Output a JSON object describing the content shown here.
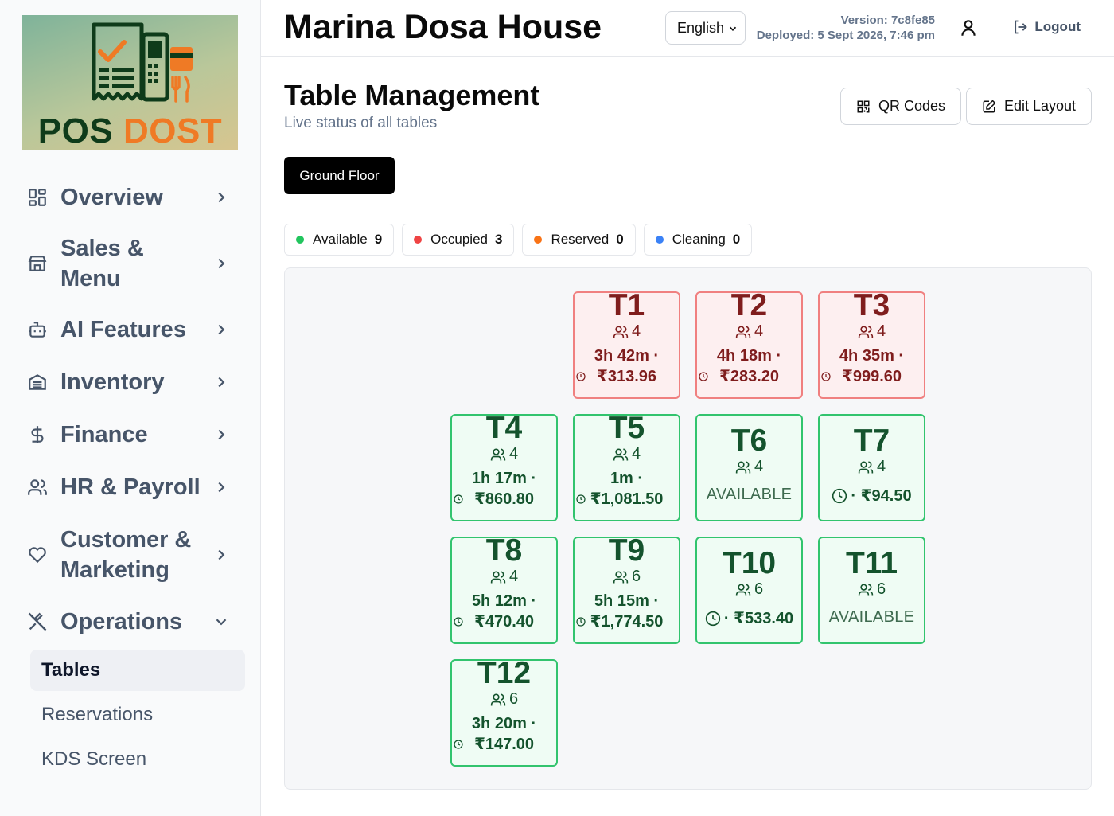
{
  "logo": {
    "word1": "POS",
    "word2": "DOST"
  },
  "sidebar": {
    "items": [
      {
        "label": "Overview",
        "icon": "layout-grid-icon"
      },
      {
        "label": "Sales & Menu",
        "icon": "store-icon"
      },
      {
        "label": "AI Features",
        "icon": "bot-icon"
      },
      {
        "label": "Inventory",
        "icon": "warehouse-icon"
      },
      {
        "label": "Finance",
        "icon": "dollar-icon"
      },
      {
        "label": "HR & Payroll",
        "icon": "users-icon"
      },
      {
        "label": "Customer & Marketing",
        "icon": "heart-icon"
      },
      {
        "label": "Operations",
        "icon": "utensils-crossed-icon"
      }
    ],
    "sub_items": [
      {
        "label": "Tables",
        "active": true
      },
      {
        "label": "Reservations",
        "active": false
      },
      {
        "label": "KDS Screen",
        "active": false
      }
    ]
  },
  "header": {
    "title": "Marina Dosa House",
    "language": "English",
    "version": "Version: 7c8fe85",
    "deployed": "Deployed: 5 Sept 2026, 7:46 pm",
    "logout": "Logout"
  },
  "main": {
    "title": "Table Management",
    "subtitle": "Live status of all tables",
    "qr_button": "QR Codes",
    "edit_button": "Edit Layout",
    "floor_tab": "Ground Floor"
  },
  "status_chips": [
    {
      "label": "Available",
      "count": "9",
      "color": "#22c55e"
    },
    {
      "label": "Occupied",
      "count": "3",
      "color": "#ef4444"
    },
    {
      "label": "Reserved",
      "count": "0",
      "color": "#f97316"
    },
    {
      "label": "Cleaning",
      "count": "0",
      "color": "#3b82f6"
    }
  ],
  "tables": [
    {
      "name": "T1",
      "seats": "4",
      "time": "3h 42m ·",
      "amount": "₹313.96",
      "style": "red"
    },
    {
      "name": "T2",
      "seats": "4",
      "time": "4h 18m ·",
      "amount": "₹283.20",
      "style": "red"
    },
    {
      "name": "T3",
      "seats": "4",
      "time": "4h 35m ·",
      "amount": "₹999.60",
      "style": "red"
    },
    {
      "name": "T4",
      "seats": "4",
      "time": "1h 17m ·",
      "amount": "₹860.80",
      "style": "green"
    },
    {
      "name": "T5",
      "seats": "4",
      "time": "1m ·",
      "amount": "₹1,081.50",
      "style": "green"
    },
    {
      "name": "T6",
      "seats": "4",
      "status": "AVAILABLE",
      "style": "green"
    },
    {
      "name": "T7",
      "seats": "4",
      "clock_amount": "· ₹94.50",
      "style": "green"
    },
    {
      "name": "T8",
      "seats": "4",
      "time": "5h 12m ·",
      "amount": "₹470.40",
      "style": "green"
    },
    {
      "name": "T9",
      "seats": "6",
      "time": "5h 15m ·",
      "amount": "₹1,774.50",
      "style": "green"
    },
    {
      "name": "T10",
      "seats": "6",
      "clock_amount": "· ₹533.40",
      "style": "green"
    },
    {
      "name": "T11",
      "seats": "6",
      "status": "AVAILABLE",
      "style": "green"
    },
    {
      "name": "T12",
      "seats": "6",
      "time": "3h 20m ·",
      "amount": "₹147.00",
      "style": "green"
    }
  ]
}
